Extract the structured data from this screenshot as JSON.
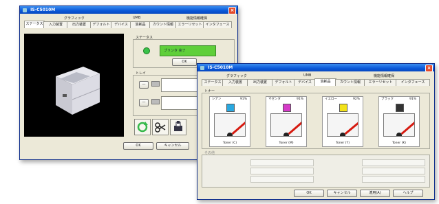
{
  "window1": {
    "title": "IS-C5010M",
    "tabs_top": [
      "グラフィック",
      "UMB",
      "機能情報確保"
    ],
    "tabs": [
      "ステータス",
      "入力装置",
      "出力装置",
      "デフォルト",
      "デバイス",
      "消耗品",
      "カウント情報",
      "エラーリセット",
      "インタフェース"
    ],
    "status_group_label": "ステータス",
    "status_text": "プリンタ 完了",
    "ok_small": "OK",
    "tray_group_label": "トレイ",
    "ok": "OK",
    "cancel": "キャンセル"
  },
  "window2": {
    "title": "IS-C5010M",
    "tabs_top": [
      "グラフィック",
      "UMB",
      "機能情報確保"
    ],
    "tabs": [
      "ステータス",
      "入力装置",
      "出力装置",
      "デフォルト",
      "デバイス",
      "消耗品",
      "カウント情報",
      "エラーリセット",
      "インタフェース"
    ],
    "toner_group_label": "トナー",
    "gauges": [
      {
        "color_name": "シアン",
        "pct": "91%",
        "swatch": "#2aa8e0",
        "label": "Toner (C)",
        "level": 0.91
      },
      {
        "color_name": "マゼンタ",
        "pct": "91%",
        "swatch": "#d53ac8",
        "label": "Toner (M)",
        "level": 0.91
      },
      {
        "color_name": "イエロー",
        "pct": "92%",
        "swatch": "#f2e21a",
        "label": "Toner (Y)",
        "level": 0.92
      },
      {
        "color_name": "ブラック",
        "pct": "91%",
        "swatch": "#333333",
        "label": "Toner (K)",
        "level": 0.91
      }
    ],
    "lower_group_label": "その他",
    "ok": "OK",
    "cancel": "キャンセル",
    "apply": "適用(A)",
    "help": "ヘルプ"
  }
}
